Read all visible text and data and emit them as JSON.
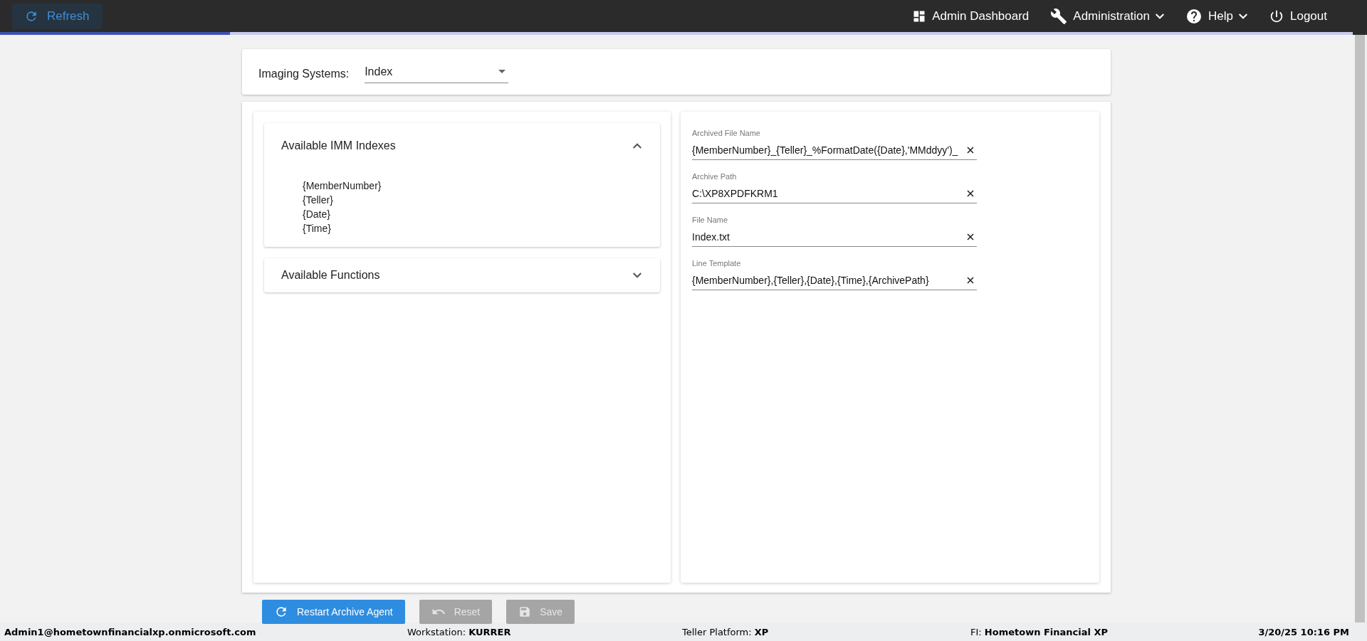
{
  "top_bar": {
    "refresh_button": {
      "label": "Refresh"
    },
    "nav": [
      {
        "label": "Admin Dashboard",
        "has_menu": false
      },
      {
        "label": "Administration",
        "has_menu": true
      },
      {
        "label": "Help",
        "has_menu": true
      },
      {
        "label": "Logout",
        "has_menu": false
      }
    ],
    "loading_bar": {
      "level": 0.17
    }
  },
  "imaging_systems": {
    "label": "Imaging Systems:",
    "value": "Index"
  },
  "accordions": [
    {
      "title": "Available IMM Indexes",
      "expanded": true,
      "items": [
        "{MemberNumber}",
        "{Teller}",
        "{Date}",
        "{Time}"
      ]
    },
    {
      "title": "Available Functions",
      "expanded": false
    }
  ],
  "fields": [
    {
      "label": "Archived File Name",
      "value": "{MemberNumber}_{Teller}_%FormatDate({Date},'MMddyy')_"
    },
    {
      "label": "Archive Path",
      "value": "C:\\XP8XPDFKRM1"
    },
    {
      "label": "File Name",
      "value": "Index.txt"
    },
    {
      "label": "Line Template",
      "value": "{MemberNumber},{Teller},{Date},{Time},{ArchivePath}"
    }
  ],
  "buttons": [
    {
      "label": "Restart Archive Agent",
      "disabled": false
    },
    {
      "label": "Reset",
      "disabled": true
    },
    {
      "label": "Save",
      "disabled": true
    }
  ],
  "status_bar": [
    {
      "value": "Admin1@hometownfinancialxp.onmicrosoft.com"
    },
    {
      "label": "Workstation:",
      "value": "KURRER"
    },
    {
      "label": "Teller Platform:",
      "value": "XP"
    },
    {
      "label": "FI:",
      "value": "Hometown Financial XP"
    },
    {
      "value": "3/20/25 10:16 PM"
    }
  ]
}
